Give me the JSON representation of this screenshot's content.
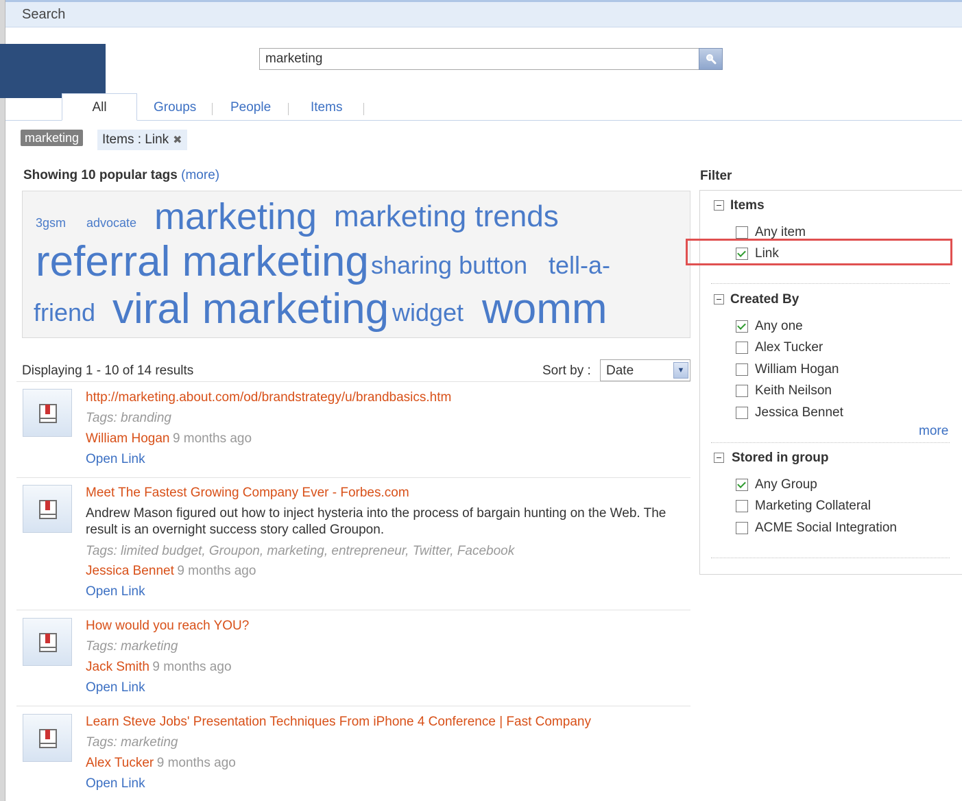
{
  "topbar": {
    "title": "Search"
  },
  "search": {
    "value": "marketing"
  },
  "tabs": [
    {
      "label": "All",
      "active": true
    },
    {
      "label": "Groups"
    },
    {
      "label": "People"
    },
    {
      "label": "Items"
    }
  ],
  "active_filters": {
    "term": "marketing",
    "filter": "Items : Link"
  },
  "tags": {
    "heading": "Showing 10 popular tags",
    "more": "(more)",
    "cloud": [
      "3gsm",
      "advocate",
      "marketing",
      "marketing trends",
      "referral marketing",
      "sharing button",
      "tell-a-",
      "friend",
      "viral marketing",
      "widget",
      "womm"
    ]
  },
  "results": {
    "count": "Displaying 1 - 10 of 14 results",
    "sort_label": "Sort by :",
    "sort_value": "Date",
    "items": [
      {
        "title": "http://marketing.about.com/od/brandstrategy/u/brandbasics.htm",
        "tags": "Tags: branding",
        "author": "William Hogan",
        "time": "9 months ago",
        "open": "Open Link"
      },
      {
        "title": "Meet The Fastest Growing Company Ever - Forbes.com",
        "desc": "Andrew Mason figured out how to inject hysteria into the process of bargain hunting on the Web. The result is an overnight success story called Groupon.",
        "tags": "Tags: limited budget, Groupon, marketing, entrepreneur, Twitter, Facebook",
        "author": "Jessica Bennet",
        "time": "9 months ago",
        "open": "Open Link"
      },
      {
        "title": "How would you reach YOU?",
        "tags": "Tags: marketing",
        "author": "Jack Smith",
        "time": "9 months ago",
        "open": "Open Link"
      },
      {
        "title": "Learn Steve Jobs' Presentation Techniques From iPhone 4 Conference | Fast Company",
        "tags": "Tags: marketing",
        "author": "Alex Tucker",
        "time": "9 months ago",
        "open": "Open Link"
      }
    ]
  },
  "filter": {
    "heading": "Filter",
    "sections": [
      {
        "title": "Items",
        "options": [
          {
            "label": "Any item",
            "checked": false
          },
          {
            "label": "Link",
            "checked": true
          }
        ]
      },
      {
        "title": "Created By",
        "options": [
          {
            "label": "Any one",
            "checked": true
          },
          {
            "label": "Alex Tucker",
            "checked": false
          },
          {
            "label": "William Hogan",
            "checked": false
          },
          {
            "label": "Keith Neilson",
            "checked": false
          },
          {
            "label": "Jessica Bennet",
            "checked": false
          }
        ],
        "more": "more"
      },
      {
        "title": "Stored in group",
        "options": [
          {
            "label": "Any Group",
            "checked": true
          },
          {
            "label": "Marketing Collateral",
            "checked": false
          },
          {
            "label": "ACME Social Integration",
            "checked": false
          }
        ]
      }
    ]
  },
  "colors": {
    "link": "#3c70c3",
    "title": "#d85018",
    "tag": "#4a7bc9",
    "highlight": "#e05050",
    "header_block": "#2c4d7c"
  }
}
